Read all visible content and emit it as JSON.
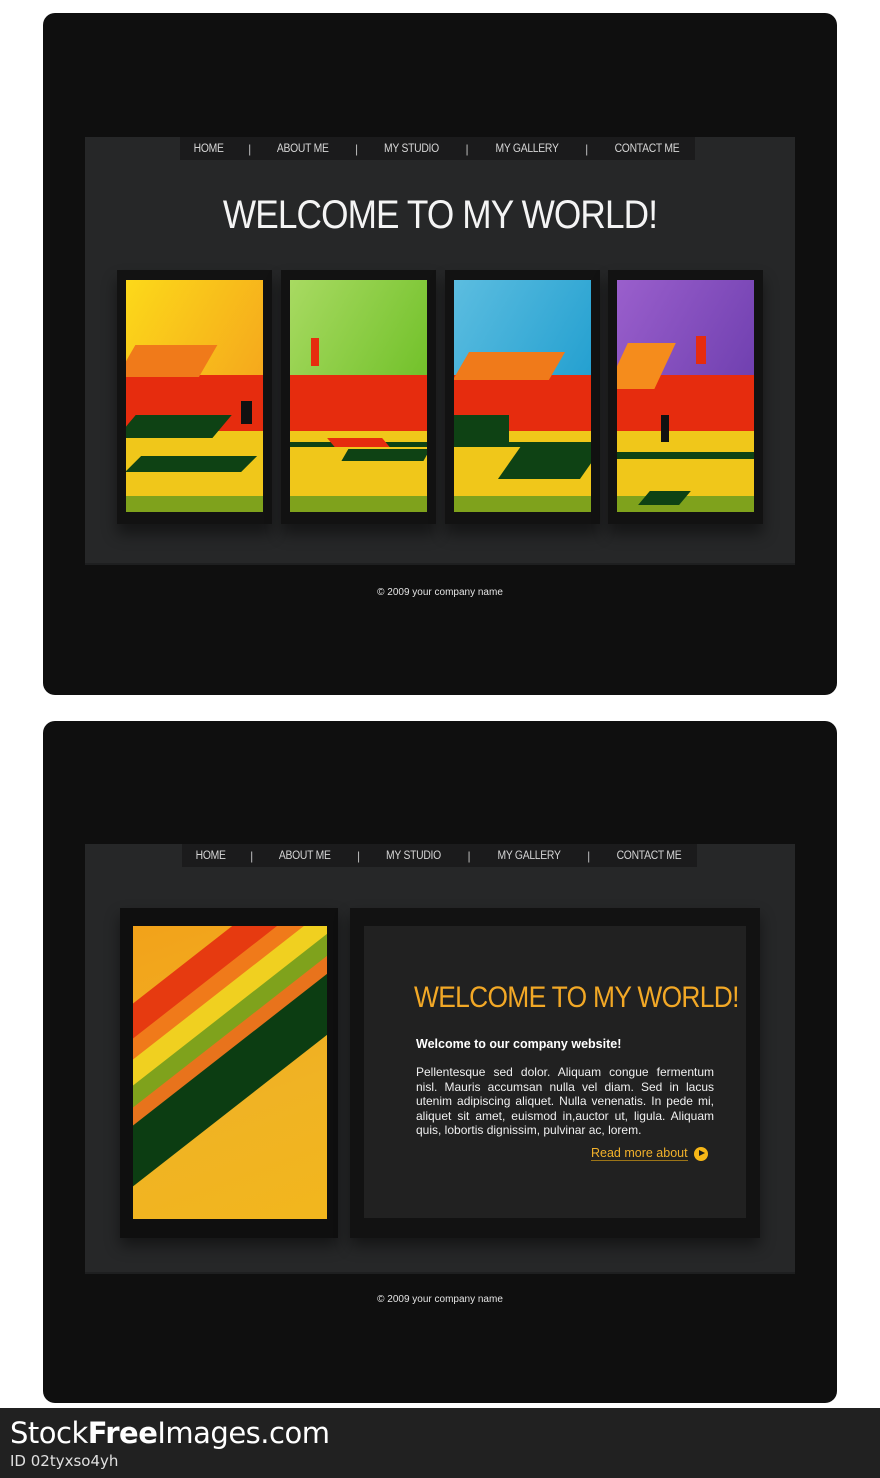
{
  "nav": {
    "items": [
      "HOME",
      "ABOUT ME",
      "MY STUDIO",
      "MY GALLERY",
      "CONTACT ME"
    ],
    "separator": "|"
  },
  "layout1": {
    "title": "WELCOME TO MY WORLD!",
    "gallery": [
      {
        "name": "artwork-yellow",
        "sky_color": "#f5b21c",
        "sky_gradient_start": "#fcd91a"
      },
      {
        "name": "artwork-green",
        "sky_color": "#7cc62a",
        "sky_gradient_start": "#a8da62"
      },
      {
        "name": "artwork-blue",
        "sky_color": "#2ea2d4",
        "sky_gradient_start": "#5cbde0"
      },
      {
        "name": "artwork-purple",
        "sky_color": "#7d45b8",
        "sky_gradient_start": "#9a5fcc"
      }
    ],
    "footer": "© 2009 your company name"
  },
  "layout2": {
    "title": "WELCOME TO MY WORLD!",
    "subheading": "Welcome to our company website!",
    "body": "Pellentesque sed dolor. Aliquam congue fermentum nisl. Mauris accumsan nulla vel diam. Sed in lacus utenim adipiscing aliquet. Nulla venenatis. In pede mi, aliquet sit amet, euismod in,auctor ut, ligula. Aliquam quis, lobortis dignissim, pulvinar ac, lorem.",
    "read_more": "Read more about",
    "footer": "© 2009 your company name"
  },
  "colors": {
    "accent": "#f2a826",
    "panel_bg": "#0f0f0f",
    "stage_bg": "#262728",
    "nav_bg": "#1b1b1c"
  },
  "watermark": {
    "brand_prefix": "Stock",
    "brand_bold": "Free",
    "brand_suffix": "Images.com",
    "id": "ID 02tyxso4yh"
  }
}
